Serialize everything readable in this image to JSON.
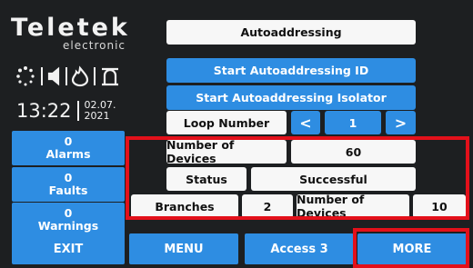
{
  "logo": {
    "brand": "Teletek",
    "sub": "electronic"
  },
  "clock": {
    "time": "13:22",
    "date_line1": "02.07.",
    "date_line2": "2021"
  },
  "sidebar": {
    "alarms": {
      "count": "0",
      "label": "Alarms"
    },
    "faults": {
      "count": "0",
      "label": "Faults"
    },
    "warnings": {
      "count": "0",
      "label": "Warnings"
    }
  },
  "main": {
    "title": "Autoaddressing",
    "start_id": "Start Autoaddressing ID",
    "start_isolator": "Start Autoaddressing Isolator",
    "loop_label": "Loop Number",
    "loop_prev": "<",
    "loop_value": "1",
    "loop_next": ">",
    "num_devices_label": "Number of Devices",
    "num_devices_value": "60",
    "status_label": "Status",
    "status_value": "Successful",
    "branches_label": "Branches",
    "branches_value": "2",
    "branch_devices_label": "Number of Devices",
    "branch_devices_value": "10"
  },
  "bottom": {
    "exit": "EXIT",
    "menu": "MENU",
    "access": "Access 3",
    "more": "MORE"
  },
  "colors": {
    "accent": "#2e8de2",
    "background": "#1d1f21",
    "highlight": "#e3101a"
  },
  "icons": [
    "loading-icon",
    "speaker-icon",
    "fire-icon",
    "siren-icon"
  ]
}
